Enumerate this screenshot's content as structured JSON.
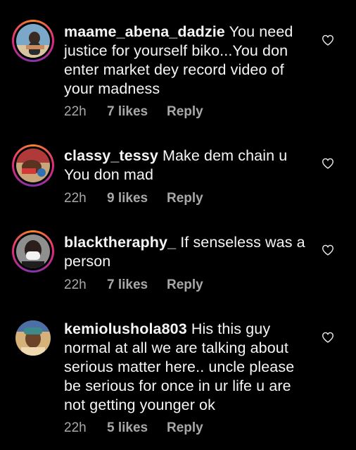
{
  "comments": [
    {
      "username": "maame_abena_dadzie",
      "text": "You need justice for yourself biko...You don enter market dey record video of your madness",
      "time": "22h",
      "likes": "7 likes",
      "reply": "Reply",
      "story_ring": true
    },
    {
      "username": "classy_tessy",
      "text": "Make dem chain u You don mad",
      "time": "22h",
      "likes": "9 likes",
      "reply": "Reply",
      "story_ring": true
    },
    {
      "username": "blacktheraphy_",
      "text": "If senseless was a person",
      "time": "22h",
      "likes": "7 likes",
      "reply": "Reply",
      "story_ring": true
    },
    {
      "username": "kemiolushola803",
      "text": "His this guy normal at all we are talking about serious matter here.. uncle please be serious for once in ur life u are not getting younger ok",
      "time": "22h",
      "likes": "5 likes",
      "reply": "Reply",
      "story_ring": false
    }
  ],
  "icons": {
    "like": "heart-outline-icon"
  },
  "colors": {
    "background": "#000000",
    "text": "#f5f5f5",
    "meta": "#a8a8a8"
  }
}
